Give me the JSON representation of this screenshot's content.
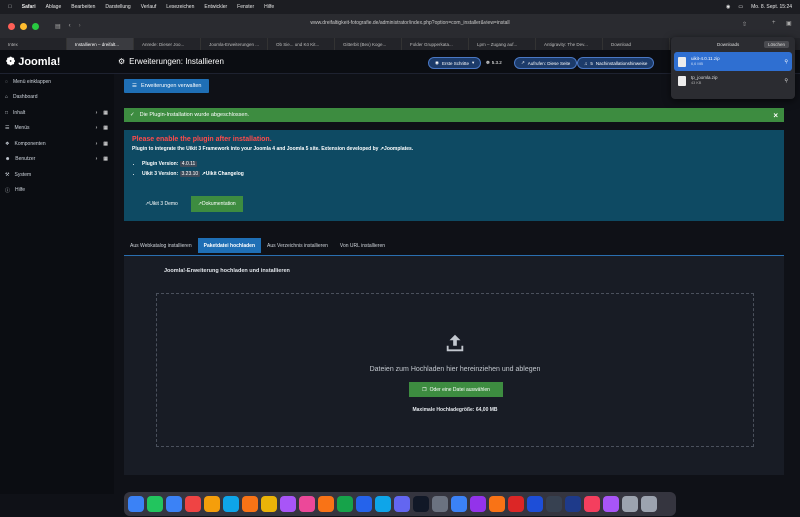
{
  "menubar": {
    "app": "Safari",
    "items": [
      "Ablage",
      "Bearbeiten",
      "Darstellung",
      "Verlauf",
      "Lesezeichen",
      "Entwickler",
      "Fenster",
      "Hilfe"
    ],
    "clock": "Mo. 8. Sept. 15:24"
  },
  "browser": {
    "url": "www.dreifaltigkeit-fotografie.de/administrator/index.php?option=com_installer&view=install",
    "tabs": [
      {
        "label": "Intex"
      },
      {
        "label": "Installieren – dreifalt..."
      },
      {
        "label": "Anrede: Dieser Joo..."
      },
      {
        "label": "Joomla-Erweiterungen ..."
      },
      {
        "label": "Ob Sie... und Kö Kit..."
      },
      {
        "label": "Gitterbit (Bex) Koge..."
      },
      {
        "label": "Folder Grupperkata..."
      },
      {
        "label": "Lpm – Zugang auf..."
      },
      {
        "label": "Antigravity: The Dev..."
      },
      {
        "label": "Download"
      }
    ],
    "downloads": {
      "title": "Downloads",
      "clear_label": "Löschen",
      "items": [
        {
          "name": "uikit-4.0.11.zip",
          "size": "6,6 MB",
          "selected": true
        },
        {
          "name": "tp_joomla.zip",
          "size": "43 KB",
          "selected": false
        }
      ]
    }
  },
  "joomla": {
    "logo": "Joomla!",
    "page_title": "Erweiterungen: Installieren",
    "header_buttons": {
      "first_steps": "Erste Schritte",
      "version": "5.3.2",
      "visit_site": "Aufrufen: Diese Seite",
      "post_install": "Nachinstallationshinweise"
    },
    "sidebar": [
      {
        "label": "Menü einklappen",
        "icon": "toggle-icon",
        "arrows": false
      },
      {
        "label": "Dashboard",
        "icon": "home-icon",
        "arrows": false
      },
      {
        "label": "Inhalt",
        "icon": "file-icon",
        "arrows": true
      },
      {
        "label": "Menüs",
        "icon": "list-icon",
        "arrows": true
      },
      {
        "label": "Komponenten",
        "icon": "puzzle-icon",
        "arrows": true
      },
      {
        "label": "Benutzer",
        "icon": "users-icon",
        "arrows": true
      },
      {
        "label": "System",
        "icon": "wrench-icon",
        "arrows": false
      },
      {
        "label": "Hilfe",
        "icon": "info-icon",
        "arrows": false
      }
    ],
    "manage_button": "Erweiterungen verwalten",
    "alert": "Die Plugin-Installation wurde abgeschlossen.",
    "info": {
      "warning": "Please enable the plugin after installation.",
      "description_prefix": "Plugin to integrate the Uikit 3 Framework into your Joomla 4 and Joomla 5 site. Extension developed by",
      "description_link": "Joomplates.",
      "plugin_version_label": "Plugin Version:",
      "plugin_version": "4.0.11",
      "uikit_version_label": "Uikit 3 Version:",
      "uikit_version": "3.23.10",
      "changelog_link": "Uikit Changelog",
      "demo_button": "Uikit 3 Demo",
      "docs_button": "Dokumentation"
    },
    "install_tabs": [
      {
        "label": "Aus Webkatalog installieren",
        "active": false
      },
      {
        "label": "Paketdatei hochladen",
        "active": true
      },
      {
        "label": "Aus Verzeichnis installieren",
        "active": false
      },
      {
        "label": "Von URL installieren",
        "active": false
      }
    ],
    "upload": {
      "heading": "Joomla!-Erweiterung hochladen und installieren",
      "drop_text": "Dateien zum Hochladen hier hereinziehen und ablegen",
      "choose_button": "Oder eine Datei auswählen",
      "max_size": "Maximale Hochladegröße: 64,00 MB"
    }
  },
  "dock": [
    "Finder",
    "Messages",
    "Mail",
    "Calendar",
    "Notes",
    "Safari",
    "Firefox",
    "Chrome",
    "Photos",
    "Music",
    "Pages",
    "Numbers",
    "Keynote",
    "Xcode",
    "Preview",
    "Terminal",
    "Settings",
    "App Store",
    "Podcasts",
    "Books",
    "Acrobat",
    "Photoshop",
    "Camera",
    "Lightroom",
    "Arc",
    "Figma",
    "Files",
    "Trash"
  ],
  "colors": {
    "accent": "#1f6fb5",
    "success": "#3d8c40",
    "info_bg": "#0e4a63",
    "danger_text": "#ff4b4b"
  }
}
